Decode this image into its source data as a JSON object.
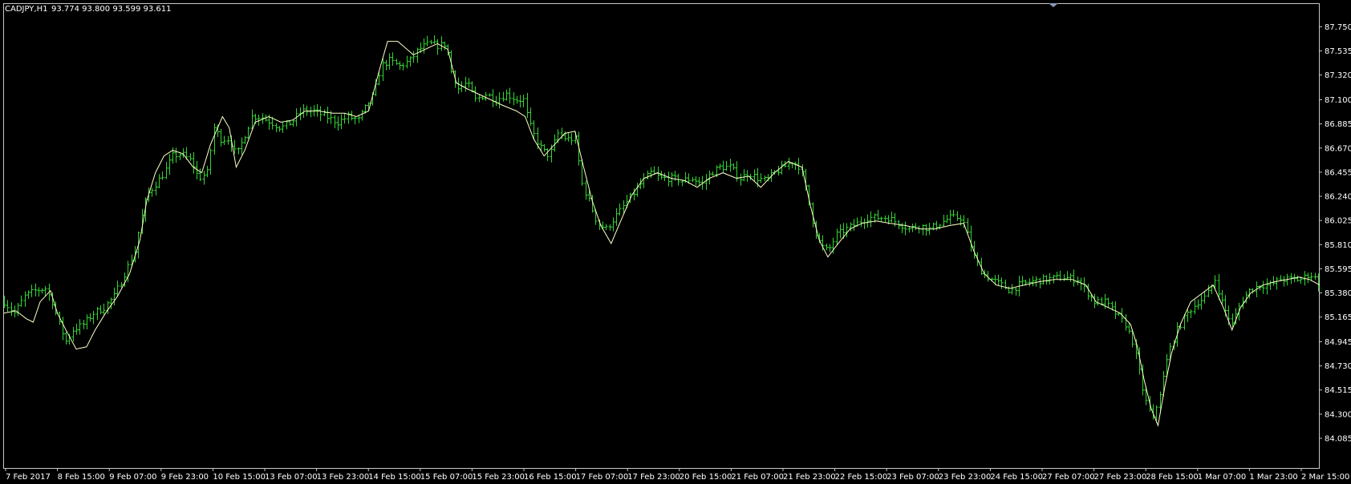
{
  "header": {
    "symbol": "CADJPY,H1",
    "quote": "93.774 93.800 93.599 93.611"
  },
  "colors": {
    "background": "#000000",
    "frame": "#c8c8c8",
    "bars": "#33d433",
    "ma_line": "#ffffc8",
    "text": "#ffffff",
    "marker": "#8a9ab5"
  },
  "chart_data": {
    "type": "ohlc",
    "timeframe": "H1",
    "ylim": [
      84.085,
      87.86
    ],
    "price_ticks": [
      "87.750",
      "87.535",
      "87.320",
      "87.100",
      "86.885",
      "86.670",
      "86.455",
      "86.240",
      "86.025",
      "85.810",
      "85.595",
      "85.380",
      "85.165",
      "84.945",
      "84.730",
      "84.515",
      "84.300",
      "84.085"
    ],
    "time_ticks": [
      "7 Feb 2017",
      "8 Feb 15:00",
      "9 Feb 07:00",
      "9 Feb 23:00",
      "10 Feb 15:00",
      "13 Feb 07:00",
      "13 Feb 23:00",
      "14 Feb 15:00",
      "15 Feb 07:00",
      "15 Feb 23:00",
      "16 Feb 15:00",
      "17 Feb 07:00",
      "17 Feb 23:00",
      "20 Feb 15:00",
      "21 Feb 07:00",
      "21 Feb 23:00",
      "22 Feb 15:00",
      "23 Feb 07:00",
      "23 Feb 23:00",
      "24 Feb 15:00",
      "27 Feb 07:00",
      "27 Feb 23:00",
      "28 Feb 15:00",
      "1 Mar 07:00",
      "1 Mar 23:00",
      "2 Mar 15:00"
    ],
    "close_path": [
      [
        0,
        85.3
      ],
      [
        12,
        85.2
      ],
      [
        24,
        85.35
      ],
      [
        36,
        85.4
      ],
      [
        48,
        85.42
      ],
      [
        56,
        85.3
      ],
      [
        64,
        85.1
      ],
      [
        72,
        84.95
      ],
      [
        80,
        85.05
      ],
      [
        92,
        85.1
      ],
      [
        104,
        85.2
      ],
      [
        116,
        85.25
      ],
      [
        128,
        85.35
      ],
      [
        140,
        85.55
      ],
      [
        152,
        85.75
      ],
      [
        158,
        86.0
      ],
      [
        166,
        86.25
      ],
      [
        176,
        86.35
      ],
      [
        186,
        86.45
      ],
      [
        196,
        86.6
      ],
      [
        206,
        86.62
      ],
      [
        218,
        86.55
      ],
      [
        226,
        86.4
      ],
      [
        236,
        86.45
      ],
      [
        244,
        86.85
      ],
      [
        252,
        86.75
      ],
      [
        262,
        86.75
      ],
      [
        270,
        86.6
      ],
      [
        278,
        86.75
      ],
      [
        288,
        86.95
      ],
      [
        298,
        86.95
      ],
      [
        310,
        86.9
      ],
      [
        322,
        86.85
      ],
      [
        334,
        86.9
      ],
      [
        346,
        87.0
      ],
      [
        360,
        87.0
      ],
      [
        374,
        86.95
      ],
      [
        388,
        86.9
      ],
      [
        400,
        86.95
      ],
      [
        412,
        86.92
      ],
      [
        422,
        87.05
      ],
      [
        430,
        87.15
      ],
      [
        438,
        87.4
      ],
      [
        448,
        87.45
      ],
      [
        460,
        87.4
      ],
      [
        472,
        87.45
      ],
      [
        482,
        87.55
      ],
      [
        494,
        87.6
      ],
      [
        506,
        87.58
      ],
      [
        514,
        87.6
      ],
      [
        520,
        87.35
      ],
      [
        528,
        87.2
      ],
      [
        538,
        87.25
      ],
      [
        548,
        87.1
      ],
      [
        560,
        87.15
      ],
      [
        572,
        87.1
      ],
      [
        584,
        87.15
      ],
      [
        596,
        87.1
      ],
      [
        604,
        87.1
      ],
      [
        610,
        86.9
      ],
      [
        618,
        86.75
      ],
      [
        626,
        86.65
      ],
      [
        634,
        86.6
      ],
      [
        644,
        86.8
      ],
      [
        654,
        86.75
      ],
      [
        664,
        86.75
      ],
      [
        672,
        86.35
      ],
      [
        680,
        86.2
      ],
      [
        690,
        86.0
      ],
      [
        700,
        85.95
      ],
      [
        710,
        86.05
      ],
      [
        720,
        86.15
      ],
      [
        730,
        86.25
      ],
      [
        740,
        86.35
      ],
      [
        752,
        86.45
      ],
      [
        764,
        86.4
      ],
      [
        776,
        86.4
      ],
      [
        788,
        86.38
      ],
      [
        800,
        86.4
      ],
      [
        812,
        86.35
      ],
      [
        822,
        86.45
      ],
      [
        832,
        86.5
      ],
      [
        844,
        86.5
      ],
      [
        856,
        86.4
      ],
      [
        866,
        86.45
      ],
      [
        876,
        86.4
      ],
      [
        886,
        86.38
      ],
      [
        896,
        86.45
      ],
      [
        906,
        86.5
      ],
      [
        916,
        86.55
      ],
      [
        926,
        86.5
      ],
      [
        934,
        86.25
      ],
      [
        942,
        85.95
      ],
      [
        950,
        85.8
      ],
      [
        958,
        85.75
      ],
      [
        968,
        85.9
      ],
      [
        980,
        85.95
      ],
      [
        992,
        86.0
      ],
      [
        1004,
        86.05
      ],
      [
        1016,
        86.05
      ],
      [
        1028,
        86.05
      ],
      [
        1040,
        86.0
      ],
      [
        1052,
        85.95
      ],
      [
        1064,
        85.98
      ],
      [
        1076,
        85.95
      ],
      [
        1088,
        86.0
      ],
      [
        1100,
        86.05
      ],
      [
        1114,
        86.05
      ],
      [
        1120,
        85.9
      ],
      [
        1128,
        85.7
      ],
      [
        1138,
        85.55
      ],
      [
        1148,
        85.5
      ],
      [
        1160,
        85.45
      ],
      [
        1170,
        85.4
      ],
      [
        1180,
        85.45
      ],
      [
        1194,
        85.48
      ],
      [
        1210,
        85.5
      ],
      [
        1230,
        85.52
      ],
      [
        1248,
        85.5
      ],
      [
        1258,
        85.4
      ],
      [
        1268,
        85.3
      ],
      [
        1280,
        85.3
      ],
      [
        1292,
        85.2
      ],
      [
        1304,
        85.1
      ],
      [
        1312,
        84.95
      ],
      [
        1318,
        84.75
      ],
      [
        1326,
        84.45
      ],
      [
        1336,
        84.25
      ],
      [
        1346,
        84.55
      ],
      [
        1354,
        84.85
      ],
      [
        1364,
        85.05
      ],
      [
        1376,
        85.2
      ],
      [
        1388,
        85.3
      ],
      [
        1398,
        85.35
      ],
      [
        1408,
        85.5
      ],
      [
        1418,
        85.25
      ],
      [
        1428,
        85.1
      ],
      [
        1438,
        85.3
      ],
      [
        1448,
        85.4
      ],
      [
        1460,
        85.45
      ],
      [
        1472,
        85.45
      ],
      [
        1484,
        85.5
      ],
      [
        1496,
        85.5
      ],
      [
        1508,
        85.5
      ],
      [
        1518,
        85.55
      ],
      [
        1526,
        85.5
      ],
      [
        1530,
        85.4
      ]
    ],
    "ma_path": [
      [
        0,
        85.2
      ],
      [
        14,
        85.22
      ],
      [
        26,
        85.15
      ],
      [
        34,
        85.12
      ],
      [
        42,
        85.3
      ],
      [
        54,
        85.4
      ],
      [
        62,
        85.2
      ],
      [
        72,
        85.05
      ],
      [
        84,
        84.88
      ],
      [
        96,
        84.9
      ],
      [
        106,
        85.05
      ],
      [
        118,
        85.2
      ],
      [
        132,
        85.35
      ],
      [
        146,
        85.55
      ],
      [
        158,
        85.85
      ],
      [
        166,
        86.2
      ],
      [
        176,
        86.45
      ],
      [
        186,
        86.6
      ],
      [
        196,
        86.65
      ],
      [
        208,
        86.62
      ],
      [
        220,
        86.5
      ],
      [
        230,
        86.45
      ],
      [
        240,
        86.7
      ],
      [
        254,
        86.95
      ],
      [
        262,
        86.85
      ],
      [
        270,
        86.5
      ],
      [
        280,
        86.65
      ],
      [
        292,
        86.9
      ],
      [
        308,
        86.95
      ],
      [
        322,
        86.9
      ],
      [
        336,
        86.92
      ],
      [
        350,
        87.0
      ],
      [
        366,
        87.0
      ],
      [
        382,
        86.98
      ],
      [
        396,
        86.98
      ],
      [
        410,
        86.95
      ],
      [
        424,
        87.0
      ],
      [
        436,
        87.35
      ],
      [
        446,
        87.62
      ],
      [
        458,
        87.62
      ],
      [
        476,
        87.5
      ],
      [
        490,
        87.55
      ],
      [
        504,
        87.6
      ],
      [
        516,
        87.55
      ],
      [
        526,
        87.25
      ],
      [
        538,
        87.2
      ],
      [
        552,
        87.15
      ],
      [
        566,
        87.1
      ],
      [
        580,
        87.05
      ],
      [
        596,
        87.0
      ],
      [
        606,
        86.95
      ],
      [
        616,
        86.75
      ],
      [
        628,
        86.6
      ],
      [
        640,
        86.7
      ],
      [
        652,
        86.8
      ],
      [
        664,
        86.82
      ],
      [
        674,
        86.5
      ],
      [
        684,
        86.2
      ],
      [
        694,
        85.98
      ],
      [
        706,
        85.82
      ],
      [
        716,
        86.0
      ],
      [
        730,
        86.25
      ],
      [
        744,
        86.4
      ],
      [
        760,
        86.45
      ],
      [
        776,
        86.4
      ],
      [
        792,
        86.38
      ],
      [
        806,
        86.32
      ],
      [
        820,
        86.4
      ],
      [
        836,
        86.45
      ],
      [
        852,
        86.4
      ],
      [
        866,
        86.42
      ],
      [
        880,
        86.32
      ],
      [
        896,
        86.45
      ],
      [
        912,
        86.55
      ],
      [
        928,
        86.5
      ],
      [
        938,
        86.15
      ],
      [
        948,
        85.85
      ],
      [
        958,
        85.7
      ],
      [
        970,
        85.82
      ],
      [
        984,
        85.95
      ],
      [
        998,
        86.0
      ],
      [
        1014,
        86.02
      ],
      [
        1030,
        86.0
      ],
      [
        1048,
        85.98
      ],
      [
        1066,
        85.95
      ],
      [
        1082,
        85.95
      ],
      [
        1100,
        85.98
      ],
      [
        1116,
        86.0
      ],
      [
        1128,
        85.75
      ],
      [
        1140,
        85.55
      ],
      [
        1154,
        85.45
      ],
      [
        1170,
        85.42
      ],
      [
        1186,
        85.45
      ],
      [
        1204,
        85.48
      ],
      [
        1222,
        85.5
      ],
      [
        1242,
        85.5
      ],
      [
        1258,
        85.45
      ],
      [
        1270,
        85.3
      ],
      [
        1284,
        85.25
      ],
      [
        1298,
        85.2
      ],
      [
        1310,
        85.1
      ],
      [
        1318,
        84.9
      ],
      [
        1326,
        84.6
      ],
      [
        1334,
        84.35
      ],
      [
        1342,
        84.2
      ],
      [
        1350,
        84.55
      ],
      [
        1358,
        84.85
      ],
      [
        1368,
        85.1
      ],
      [
        1380,
        85.3
      ],
      [
        1394,
        85.38
      ],
      [
        1406,
        85.45
      ],
      [
        1418,
        85.25
      ],
      [
        1428,
        85.05
      ],
      [
        1438,
        85.25
      ],
      [
        1450,
        85.38
      ],
      [
        1464,
        85.45
      ],
      [
        1478,
        85.48
      ],
      [
        1492,
        85.5
      ],
      [
        1506,
        85.52
      ],
      [
        1518,
        85.5
      ],
      [
        1530,
        85.45
      ]
    ]
  }
}
